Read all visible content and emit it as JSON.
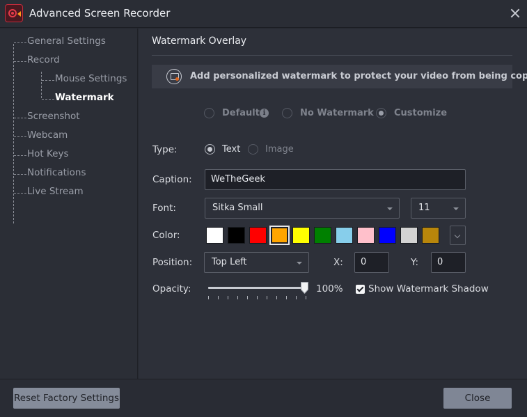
{
  "window": {
    "title": "Advanced Screen Recorder",
    "logo_icon": "camera-record-icon",
    "close_icon": "close-icon"
  },
  "sidebar": {
    "items": [
      {
        "label": "General Settings",
        "active": false
      },
      {
        "label": "Record",
        "active": false
      },
      {
        "label": "Mouse Settings",
        "active": false
      },
      {
        "label": "Watermark",
        "active": true
      },
      {
        "label": "Screenshot",
        "active": false
      },
      {
        "label": "Webcam",
        "active": false
      },
      {
        "label": "Hot Keys",
        "active": false
      },
      {
        "label": "Notifications",
        "active": false
      },
      {
        "label": "Live Stream",
        "active": false
      }
    ]
  },
  "main": {
    "title": "Watermark Overlay",
    "banner": {
      "icon": "watermark-image-icon",
      "text": "Add personalized watermark to protect your video from being copied"
    },
    "mode": {
      "options": [
        "Default",
        "No Watermark",
        "Customize"
      ],
      "selected": "Customize",
      "info_icon_glyph": "i"
    },
    "type": {
      "label": "Type:",
      "options": [
        "Text",
        "Image"
      ],
      "selected": "Text"
    },
    "caption": {
      "label": "Caption:",
      "value": "WeTheGeek"
    },
    "font": {
      "label": "Font:",
      "family": "Sitka Small",
      "size": "11"
    },
    "color": {
      "label": "Color:",
      "swatches": [
        "#ffffff",
        "#000000",
        "#ff0000",
        "#ffa500",
        "#ffff00",
        "#008000",
        "#87ceeb",
        "#ffc0cb",
        "#0000ff",
        "#d3d3d3",
        "#b8860b"
      ],
      "selected": "#ffa500"
    },
    "position": {
      "label": "Position:",
      "value": "Top Left",
      "x_label": "X:",
      "x_value": "0",
      "y_label": "Y:",
      "y_value": "0"
    },
    "opacity": {
      "label": "Opacity:",
      "value_text": "100%",
      "level": 1.0
    },
    "shadow": {
      "label": "Show Watermark Shadow",
      "checked": true
    }
  },
  "footer": {
    "reset_label": "Reset Factory Settings",
    "close_label": "Close"
  }
}
